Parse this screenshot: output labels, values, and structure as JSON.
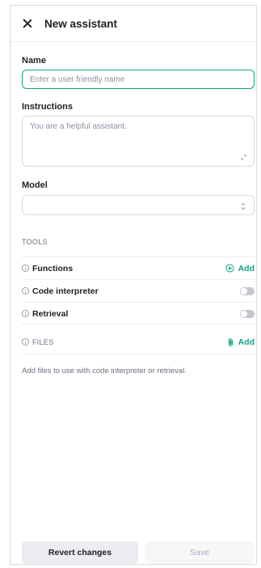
{
  "header": {
    "title": "New assistant",
    "close_icon": "close-icon"
  },
  "name_field": {
    "label": "Name",
    "placeholder": "Enter a user friendly name",
    "value": ""
  },
  "instructions_field": {
    "label": "Instructions",
    "placeholder": "You are a helpful assistant.",
    "value": ""
  },
  "model_field": {
    "label": "Model",
    "value": ""
  },
  "tools": {
    "section_label": "TOOLS",
    "items": [
      {
        "label": "Functions",
        "action": "Add",
        "action_icon": "plus-circle-icon"
      },
      {
        "label": "Code interpreter",
        "enabled": false
      },
      {
        "label": "Retrieval",
        "enabled": false
      }
    ]
  },
  "files": {
    "section_label": "FILES",
    "action": "Add",
    "action_icon": "paperclip-icon",
    "hint": "Add files to use with code interpreter or retrieval."
  },
  "footer": {
    "revert_label": "Revert changes",
    "save_label": "Save"
  },
  "colors": {
    "accent": "#10a37f",
    "border": "#d9d9e3",
    "muted_text": "#6e6e80"
  }
}
